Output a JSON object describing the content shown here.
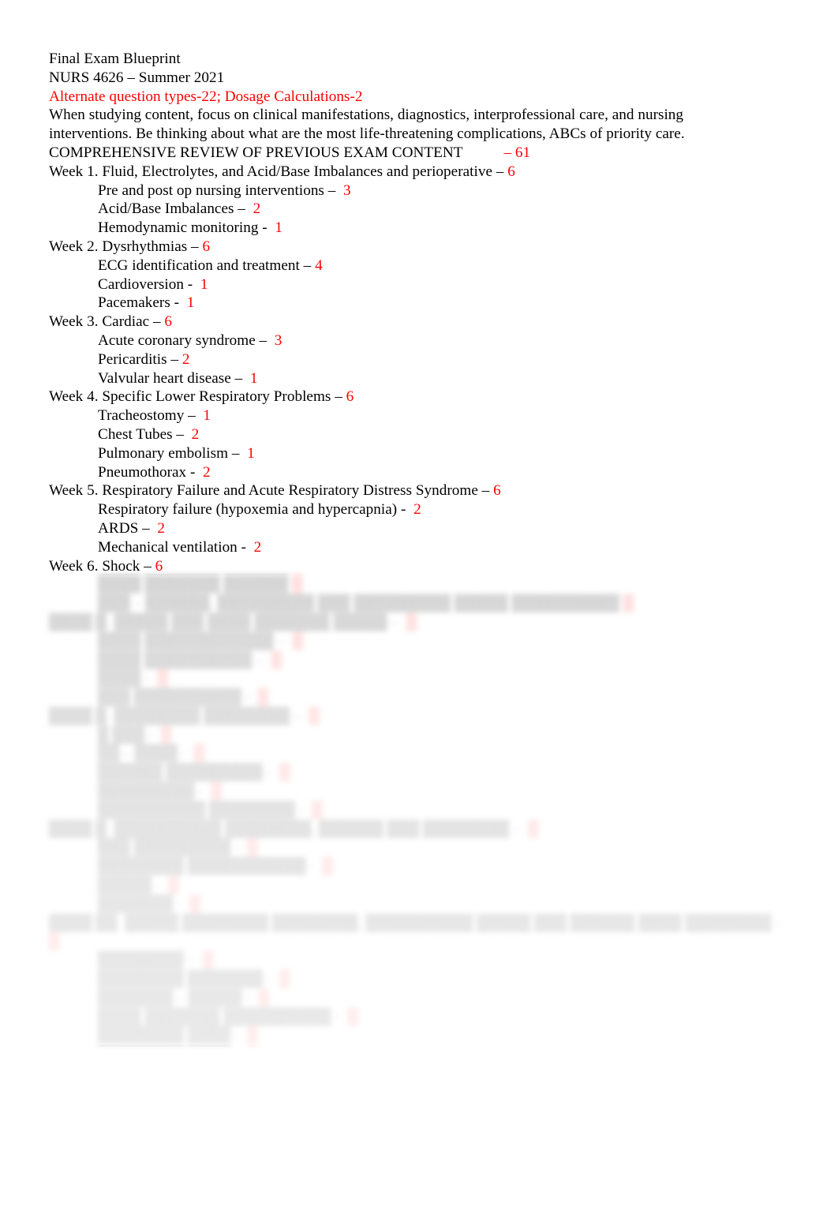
{
  "document": {
    "title_line": "Final Exam Blueprint",
    "course_line": "NURS 4626 – Summer 2021",
    "alternate_line": "Alternate question types-22; Dosage Calculations-2",
    "intro_line_1": "When studying content, focus on clinical manifestations, diagnostics, interprofessional care, and nursing",
    "intro_line_2": "interventions. Be thinking about what are the most life-threatening complications, ABCs of priority care.",
    "comprehensive_label": "COMPREHENSIVE REVIEW OF PREVIOUS EXAM CONTENT",
    "comprehensive_dash": "– ",
    "comprehensive_count": "61"
  },
  "weeks": [
    {
      "heading": "Week 1. Fluid, Electrolytes, and Acid/Base Imbalances and perioperative – ",
      "count": "6",
      "items": [
        {
          "label": "Pre and post op nursing interventions – ",
          "count": "3"
        },
        {
          "label": "Acid/Base Imbalances – ",
          "count": "2"
        },
        {
          "label": "Hemodynamic monitoring - ",
          "count": "1"
        }
      ]
    },
    {
      "heading": "Week 2. Dysrhythmias – ",
      "count": "6",
      "items": [
        {
          "label": "ECG identification and treatment –",
          "count": "4"
        },
        {
          "label": "Cardioversion - ",
          "count": "1"
        },
        {
          "label": "Pacemakers - ",
          "count": "1"
        }
      ]
    },
    {
      "heading": "Week 3. Cardiac – ",
      "count": "6",
      "items": [
        {
          "label": "Acute coronary syndrome – ",
          "count": "3"
        },
        {
          "label": "Pericarditis –",
          "count": "2"
        },
        {
          "label": "Valvular heart disease – ",
          "count": "1"
        }
      ]
    },
    {
      "heading": "Week 4. Specific Lower Respiratory Problems – ",
      "count": "6",
      "items": [
        {
          "label": "Tracheostomy – ",
          "count": "1"
        },
        {
          "label": "Chest Tubes – ",
          "count": "2"
        },
        {
          "label": "Pulmonary embolism – ",
          "count": "1"
        },
        {
          "label": "Pneumothorax - ",
          "count": "2"
        }
      ]
    },
    {
      "heading": "Week 5. Respiratory Failure and Acute Respiratory Distress Syndrome – ",
      "count": "6",
      "items": [
        {
          "label": "Respiratory failure (hypoxemia and hypercapnia) - ",
          "count": "2"
        },
        {
          "label": "ARDS – ",
          "count": "2"
        },
        {
          "label": "Mechanical ventilation - ",
          "count": "2"
        }
      ]
    },
    {
      "heading": "Week 6. Shock – ",
      "count": "6",
      "items": []
    }
  ],
  "obscured_section": {
    "note": "Lower portion of the page is blurred and illegible in the screenshot.",
    "lines": [
      {
        "indent": 1,
        "text": "████ ███████ ██████",
        "count": "█"
      },
      {
        "indent": 1,
        "text": "███ – ██████, █████████ ███ █████████ █████ ██████████",
        "count": "█"
      },
      {
        "indent": 0,
        "text": "████ █. █████ ███ ████ ███████ █████ – ",
        "count": "█"
      },
      {
        "indent": 1,
        "text": "████ ████████████ – ",
        "count": "█"
      },
      {
        "indent": 1,
        "text": "████ ██████████ – ",
        "count": "█"
      },
      {
        "indent": 1,
        "text": "████ - ",
        "count": "█"
      },
      {
        "indent": 1,
        "text": "███ ██████████ - ",
        "count": "█"
      },
      {
        "indent": 0,
        "text": "████ █. ████████ ████████ – ",
        "count": "█"
      },
      {
        "indent": 1,
        "text": "█ ███ - ",
        "count": "█"
      },
      {
        "indent": 1,
        "text": "██ – ████ - ",
        "count": "█"
      },
      {
        "indent": 1,
        "text": "██████ █████████ - ",
        "count": "█"
      },
      {
        "indent": 1,
        "text": "█████████ - ",
        "count": "█"
      },
      {
        "indent": 1,
        "text": "██████████ ████████ - ",
        "count": "█"
      },
      {
        "indent": 0,
        "text": "████ █. ██████████ ████████, ██████ ███ ████████ – ",
        "count": "█"
      },
      {
        "indent": 1,
        "text": "███ █████████ - ",
        "count": "█"
      },
      {
        "indent": 1,
        "text": "████████ ███████████ - ",
        "count": "█"
      },
      {
        "indent": 1,
        "text": "█████ - ",
        "count": "█"
      },
      {
        "indent": 1,
        "text": "███████ - ",
        "count": "█"
      },
      {
        "indent": 0,
        "text": "████ ██. █████ ████████ ████████, ██████████ █████ ███ ██████ ████ ████████ – ",
        "count": "█"
      },
      {
        "indent": 1,
        "text": "████████ – ",
        "count": "█"
      },
      {
        "indent": 1,
        "text": "████████ ███████ - ",
        "count": "█"
      },
      {
        "indent": 1,
        "text": "███████ – █████ - ",
        "count": "█"
      },
      {
        "indent": 1,
        "text": "████ ███████ ██████████ - ",
        "count": "█"
      },
      {
        "indent": 1,
        "text": "████████ ████ - ",
        "count": "█"
      }
    ]
  },
  "colors": {
    "accent_red": "#ff0000",
    "text_black": "#000000",
    "page_background": "#ffffff"
  }
}
